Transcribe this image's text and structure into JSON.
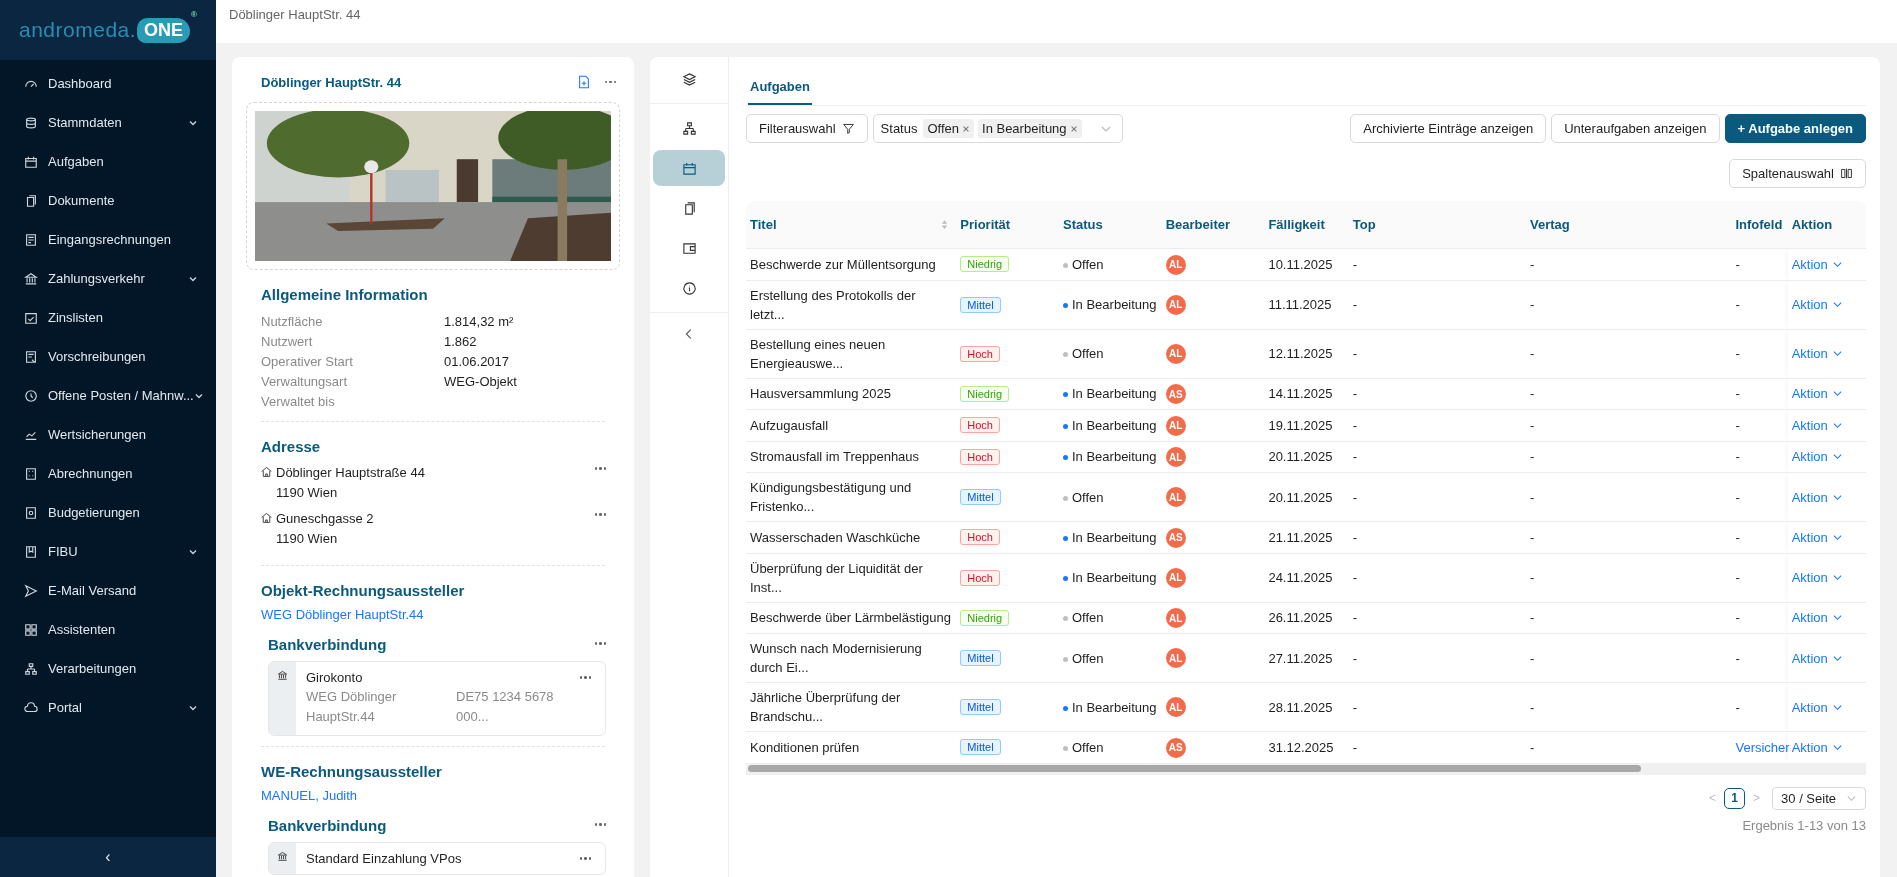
{
  "logo": {
    "text": "andromeda.",
    "badge": "ONE",
    "mark": "®"
  },
  "sidebar": {
    "items": [
      {
        "label": "Dashboard",
        "expandable": false
      },
      {
        "label": "Stammdaten",
        "expandable": true
      },
      {
        "label": "Aufgaben",
        "expandable": false
      },
      {
        "label": "Dokumente",
        "expandable": false
      },
      {
        "label": "Eingangsrechnungen",
        "expandable": false
      },
      {
        "label": "Zahlungsverkehr",
        "expandable": true
      },
      {
        "label": "Zinslisten",
        "expandable": false
      },
      {
        "label": "Vorschreibungen",
        "expandable": false
      },
      {
        "label": "Offene Posten / Mahnw...",
        "expandable": true
      },
      {
        "label": "Wertsicherungen",
        "expandable": false
      },
      {
        "label": "Abrechnungen",
        "expandable": false
      },
      {
        "label": "Budgetierungen",
        "expandable": false
      },
      {
        "label": "FIBU",
        "expandable": true
      },
      {
        "label": "E-Mail Versand",
        "expandable": false
      },
      {
        "label": "Assistenten",
        "expandable": false
      },
      {
        "label": "Verarbeitungen",
        "expandable": false
      },
      {
        "label": "Portal",
        "expandable": true
      }
    ],
    "collapse": "‹"
  },
  "breadcrumb": "Döblinger HauptStr. 44",
  "object_panel": {
    "title": "Döblinger HauptStr. 44",
    "general": {
      "heading": "Allgemeine Information",
      "fields": [
        {
          "label": "Nutzfläche",
          "value": "1.814,32 m²"
        },
        {
          "label": "Nutzwert",
          "value": "1.862"
        },
        {
          "label": "Operativer Start",
          "value": "01.06.2017"
        },
        {
          "label": "Verwaltungsart",
          "value": "WEG-Objekt"
        },
        {
          "label": "Verwaltet bis"
        }
      ]
    },
    "address": {
      "heading": "Adresse",
      "items": [
        {
          "street": "Döblinger Hauptstraße 44",
          "city": "1190 Wien"
        },
        {
          "street": "Guneschgasse 2",
          "city": "1190 Wien"
        }
      ]
    },
    "issuers": [
      {
        "heading": "Objekt-Rechnungsaussteller",
        "link": "WEG Döblinger HauptStr.44",
        "bank_heading": "Bankverbindung",
        "account": {
          "name": "Girokonto",
          "holder": "WEG Döblinger HauptStr.44",
          "iban": "DE75 1234 5678 000..."
        }
      },
      {
        "heading": "WE-Rechnungsaussteller",
        "link": "MANUEL, Judith",
        "bank_heading": "Bankverbindung",
        "account": {
          "name": "Standard Einzahlung VPos"
        }
      }
    ]
  },
  "side_tabs": [
    {
      "selected": false
    },
    {
      "selected": false
    },
    {
      "selected": true
    },
    {
      "selected": false
    },
    {
      "selected": false
    },
    {
      "selected": false
    }
  ],
  "tabs": [
    {
      "label": "Aufgaben",
      "selected": true
    }
  ],
  "filters": {
    "filter_button": "Filterauswahl",
    "status_label": "Status",
    "status_tags": [
      "Offen",
      "In Bearbeitung"
    ]
  },
  "actions": [
    {
      "label": "Archivierte Einträge anzeigen",
      "primary": false
    },
    {
      "label": "Unteraufgaben anzeigen",
      "primary": false
    },
    {
      "label": "+ Aufgabe anlegen",
      "primary": true
    }
  ],
  "column_select": "Spaltenauswahl",
  "table": {
    "columns": [
      "Titel",
      "Priorität",
      "Status",
      "Bearbeiter",
      "Fälligkeit",
      "Top",
      "Vertag",
      "Infofeld",
      "Aktion"
    ],
    "rows": [
      {
        "title": "Beschwerde zur Müllentsorgung",
        "priority": {
          "label": "Niedrig",
          "kind": "low"
        },
        "status": {
          "label": "Offen",
          "kind": "open"
        },
        "assignee": "AL",
        "due": "10.11.2025",
        "top": "-",
        "vertag": "-",
        "infofeld": {
          "text": "-",
          "link": false
        },
        "action": "Aktion"
      },
      {
        "title": "Erstellung des Protokolls der letzt...",
        "priority": {
          "label": "Mittel",
          "kind": "medium"
        },
        "status": {
          "label": "In Bearbeitung",
          "kind": "progress"
        },
        "assignee": "AL",
        "due": "11.11.2025",
        "top": "-",
        "vertag": "-",
        "infofeld": {
          "text": "-",
          "link": false
        },
        "action": "Aktion"
      },
      {
        "title": "Bestellung eines neuen Energieauswe...",
        "priority": {
          "label": "Hoch",
          "kind": "high"
        },
        "status": {
          "label": "Offen",
          "kind": "open"
        },
        "assignee": "AL",
        "due": "12.11.2025",
        "top": "-",
        "vertag": "-",
        "infofeld": {
          "text": "-",
          "link": false
        },
        "action": "Aktion"
      },
      {
        "title": "Hausversammlung 2025",
        "priority": {
          "label": "Niedrig",
          "kind": "low"
        },
        "status": {
          "label": "In Bearbeitung",
          "kind": "progress"
        },
        "assignee": "AS",
        "due": "14.11.2025",
        "top": "-",
        "vertag": "-",
        "infofeld": {
          "text": "-",
          "link": false
        },
        "action": "Aktion"
      },
      {
        "title": "Aufzugausfall",
        "priority": {
          "label": "Hoch",
          "kind": "high"
        },
        "status": {
          "label": "In Bearbeitung",
          "kind": "progress"
        },
        "assignee": "AL",
        "due": "19.11.2025",
        "top": "-",
        "vertag": "-",
        "infofeld": {
          "text": "-",
          "link": false
        },
        "action": "Aktion"
      },
      {
        "title": "Stromausfall im Treppenhaus",
        "priority": {
          "label": "Hoch",
          "kind": "high"
        },
        "status": {
          "label": "In Bearbeitung",
          "kind": "progress"
        },
        "assignee": "AL",
        "due": "20.11.2025",
        "top": "-",
        "vertag": "-",
        "infofeld": {
          "text": "-",
          "link": false
        },
        "action": "Aktion"
      },
      {
        "title": "Kündigungsbestätigung und Fristenko...",
        "priority": {
          "label": "Mittel",
          "kind": "medium"
        },
        "status": {
          "label": "Offen",
          "kind": "open"
        },
        "assignee": "AL",
        "due": "20.11.2025",
        "top": "-",
        "vertag": "-",
        "infofeld": {
          "text": "-",
          "link": false
        },
        "action": "Aktion"
      },
      {
        "title": "Wasserschaden Waschküche",
        "priority": {
          "label": "Hoch",
          "kind": "high"
        },
        "status": {
          "label": "In Bearbeitung",
          "kind": "progress"
        },
        "assignee": "AS",
        "due": "21.11.2025",
        "top": "-",
        "vertag": "-",
        "infofeld": {
          "text": "-",
          "link": false
        },
        "action": "Aktion"
      },
      {
        "title": "Überprüfung der Liquidität der Inst...",
        "priority": {
          "label": "Hoch",
          "kind": "high"
        },
        "status": {
          "label": "In Bearbeitung",
          "kind": "progress"
        },
        "assignee": "AL",
        "due": "24.11.2025",
        "top": "-",
        "vertag": "-",
        "infofeld": {
          "text": "-",
          "link": false
        },
        "action": "Aktion"
      },
      {
        "title": "Beschwerde über Lärmbelästigung",
        "priority": {
          "label": "Niedrig",
          "kind": "low"
        },
        "status": {
          "label": "Offen",
          "kind": "open"
        },
        "assignee": "AL",
        "due": "26.11.2025",
        "top": "-",
        "vertag": "-",
        "infofeld": {
          "text": "-",
          "link": false
        },
        "action": "Aktion"
      },
      {
        "title": "Wunsch nach Modernisierung durch Ei...",
        "priority": {
          "label": "Mittel",
          "kind": "medium"
        },
        "status": {
          "label": "Offen",
          "kind": "open"
        },
        "assignee": "AL",
        "due": "27.11.2025",
        "top": "-",
        "vertag": "-",
        "infofeld": {
          "text": "-",
          "link": false
        },
        "action": "Aktion"
      },
      {
        "title": "Jährliche Überprüfung der Brandschu...",
        "priority": {
          "label": "Mittel",
          "kind": "medium"
        },
        "status": {
          "label": "In Bearbeitung",
          "kind": "progress"
        },
        "assignee": "AL",
        "due": "28.11.2025",
        "top": "-",
        "vertag": "-",
        "infofeld": {
          "text": "-",
          "link": false
        },
        "action": "Aktion"
      },
      {
        "title": "Konditionen prüfen",
        "priority": {
          "label": "Mittel",
          "kind": "medium"
        },
        "status": {
          "label": "Offen",
          "kind": "open"
        },
        "assignee": "AS",
        "due": "31.12.2025",
        "top": "-",
        "vertag": "-",
        "infofeld": {
          "text": "Versicher",
          "link": true
        },
        "action": "Aktion"
      }
    ]
  },
  "pagination": {
    "prev": "<",
    "pages": [
      {
        "label": "1",
        "selected": true
      }
    ],
    "next": ">",
    "page_size": "30 / Seite",
    "result": "Ergebnis 1-13 von 13"
  }
}
